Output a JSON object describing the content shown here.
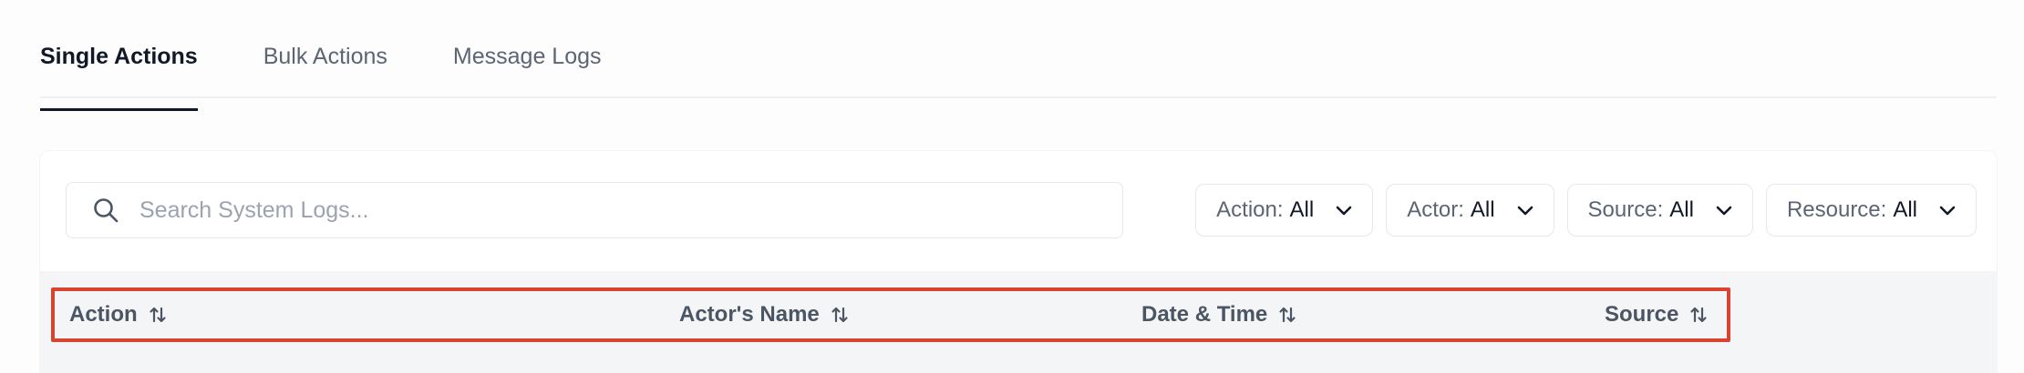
{
  "tabs": [
    {
      "label": "Single Actions",
      "active": true
    },
    {
      "label": "Bulk Actions",
      "active": false
    },
    {
      "label": "Message Logs",
      "active": false
    }
  ],
  "search": {
    "placeholder": "Search System Logs...",
    "value": "",
    "icon": "search-icon"
  },
  "filters": [
    {
      "label": "Action:",
      "value": "All",
      "icon": "chevron-down-icon"
    },
    {
      "label": "Actor:",
      "value": "All",
      "icon": "chevron-down-icon"
    },
    {
      "label": "Source:",
      "value": "All",
      "icon": "chevron-down-icon"
    },
    {
      "label": "Resource:",
      "value": "All",
      "icon": "chevron-down-icon"
    }
  ],
  "table": {
    "columns": [
      {
        "label": "Action",
        "icon": "sort-icon"
      },
      {
        "label": "Actor's Name",
        "icon": "sort-icon"
      },
      {
        "label": "Date & Time",
        "icon": "sort-icon"
      },
      {
        "label": "Source",
        "icon": "sort-icon"
      }
    ]
  },
  "colors": {
    "highlight": "#d9432f",
    "active_tab": "#111827",
    "muted_text": "#5b6574",
    "header_band": "#f4f5f7"
  }
}
